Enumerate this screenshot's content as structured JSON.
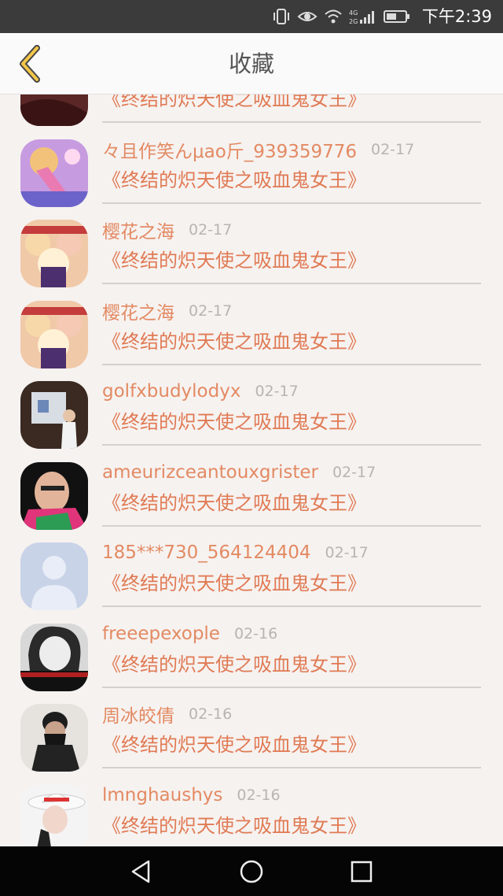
{
  "status_bar": {
    "time": "下午2:39",
    "network": "4G 2G"
  },
  "header": {
    "title": "收藏"
  },
  "accent_color": "#e07a54",
  "items": [
    {
      "name": "",
      "date": "",
      "work": "《终结的炽天使之吸血鬼女王》",
      "avatar": "anime-avatar"
    },
    {
      "name": "々且作笑んμao斤_939359776",
      "date": "02-17",
      "work": "《终结的炽天使之吸血鬼女王》",
      "avatar": "anime-avatar"
    },
    {
      "name": "樱花之海",
      "date": "02-17",
      "work": "《终结的炽天使之吸血鬼女王》",
      "avatar": "anime-group-avatar"
    },
    {
      "name": "樱花之海",
      "date": "02-17",
      "work": "《终结的炽天使之吸血鬼女王》",
      "avatar": "anime-group-avatar"
    },
    {
      "name": "golfxbudylodyx",
      "date": "02-17",
      "work": "《终结的炽天使之吸血鬼女王》",
      "avatar": "photo-avatar"
    },
    {
      "name": "ameurizceantouxgrister",
      "date": "02-17",
      "work": "《终结的炽天使之吸血鬼女王》",
      "avatar": "portrait-avatar"
    },
    {
      "name": "185***730_564124404",
      "date": "02-17",
      "work": "《终结的炽天使之吸血鬼女王》",
      "avatar": "default-avatar"
    },
    {
      "name": "freeepexople",
      "date": "02-16",
      "work": "《终结的炽天使之吸血鬼女王》",
      "avatar": "portrait-bw-avatar"
    },
    {
      "name": "周冰皎倩",
      "date": "02-16",
      "work": "《终结的炽天使之吸血鬼女王》",
      "avatar": "masked-avatar"
    },
    {
      "name": "lmnghaushys",
      "date": "02-16",
      "work": "《终结的炽天使之吸血鬼女王》",
      "avatar": "hat-avatar"
    }
  ],
  "nav": {
    "back": "back-triangle-icon",
    "home": "home-circle-icon",
    "recents": "recents-square-icon"
  }
}
